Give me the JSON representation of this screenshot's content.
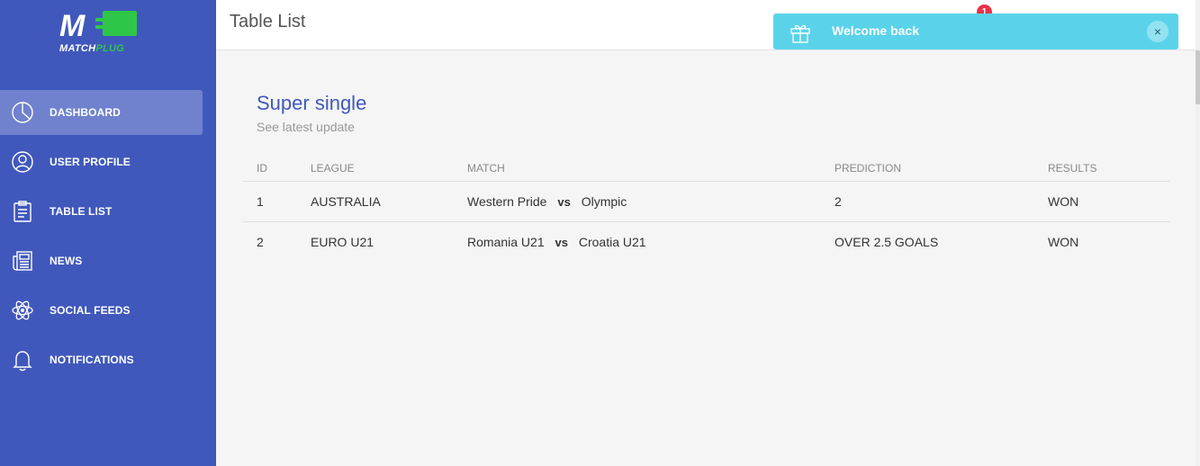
{
  "brand": {
    "letter": "M",
    "name_part1": "MATCH",
    "name_part2": "PLUG"
  },
  "sidebar": {
    "items": [
      {
        "label": "DASHBOARD",
        "icon": "pie-chart-icon",
        "active": true
      },
      {
        "label": "USER PROFILE",
        "icon": "user-icon",
        "active": false
      },
      {
        "label": "TABLE LIST",
        "icon": "clipboard-icon",
        "active": false
      },
      {
        "label": "NEWS",
        "icon": "newspaper-icon",
        "active": false
      },
      {
        "label": "SOCIAL FEEDS",
        "icon": "atom-icon",
        "active": false
      },
      {
        "label": "NOTIFICATIONS",
        "icon": "bell-icon",
        "active": false
      }
    ]
  },
  "header": {
    "title": "Table List",
    "notification_count": "1"
  },
  "toast": {
    "message": "Welcome back",
    "icon": "gift-icon",
    "close": "×"
  },
  "card": {
    "title": "Super single",
    "subtitle": "See latest update",
    "columns": [
      "ID",
      "LEAGUE",
      "MATCH",
      "PREDICTION",
      "RESULTS"
    ],
    "rows": [
      {
        "id": "1",
        "league": "AUSTRALIA",
        "home": "Western Pride",
        "vs": "vs",
        "away": "Olympic",
        "prediction": "2",
        "result": "WON"
      },
      {
        "id": "2",
        "league": "EURO U21",
        "home": "Romania U21",
        "vs": "vs",
        "away": "Croatia U21",
        "prediction": "OVER 2.5 GOALS",
        "result": "WON"
      }
    ]
  },
  "colors": {
    "sidebar": "#4058bc",
    "accent_green": "#2ec648",
    "toast": "#5ad3ea",
    "badge": "#e8324a",
    "title_blue": "#4058bc"
  }
}
